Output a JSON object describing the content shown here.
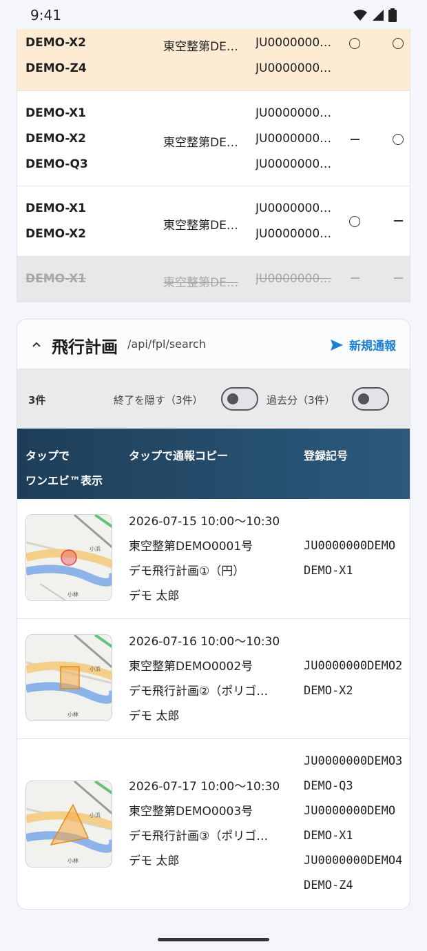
{
  "status": {
    "time": "9:41"
  },
  "top_rows": [
    {
      "names": [
        "DEMO-X2",
        "DEMO-Z4"
      ],
      "org": "東空整第DE…",
      "codes": [
        "JU0000000…",
        "JU0000000…"
      ],
      "m1": "circle",
      "m2": "circle"
    },
    {
      "names": [
        "DEMO-X1",
        "DEMO-X2",
        "DEMO-Q3"
      ],
      "org": "東空整第DE…",
      "codes": [
        "JU0000000…",
        "JU0000000…",
        "JU0000000…"
      ],
      "m1": "dash",
      "m2": "circle"
    },
    {
      "names": [
        "DEMO-X1",
        "DEMO-X2"
      ],
      "org": "東空整第DE…",
      "codes": [
        "JU0000000…",
        "JU0000000…"
      ],
      "m1": "circle",
      "m2": "dash"
    },
    {
      "names": [
        "DEMO-X1"
      ],
      "org": "東空整第DE…",
      "codes": [
        "JU0000000…"
      ],
      "m1": "dash",
      "m2": "dash"
    }
  ],
  "fpl": {
    "title": "飛行計画",
    "path": "/api/fpl/search",
    "new_report": "新規通報",
    "count": "3件",
    "hide_finished": "終了を隠す（3件）",
    "past": "過去分（3件）",
    "headers": {
      "col1_line1": "タップで",
      "col1_line2": "ワンエビ™表示",
      "col2": "タップで通報コピー",
      "col3": "登録記号"
    },
    "rows": [
      {
        "time": "2026-07-15 10:00〜10:30",
        "permit": "東空整第DEMO0001号",
        "plan": "デモ飛行計画①（円）",
        "person": "デモ 太郎",
        "regs": [
          "JU0000000DEMO",
          "DEMO-X1"
        ]
      },
      {
        "time": "2026-07-16 10:00〜10:30",
        "permit": "東空整第DEMO0002号",
        "plan": "デモ飛行計画②（ポリゴ…",
        "person": "デモ 太郎",
        "regs": [
          "JU0000000DEMO2",
          "DEMO-X2"
        ]
      },
      {
        "time": "2026-07-17 10:00〜10:30",
        "permit": "東空整第DEMO0003号",
        "plan": "デモ飛行計画③（ポリゴ…",
        "person": "デモ 太郎",
        "regs": [
          "JU0000000DEMO3",
          "DEMO-Q3",
          "JU0000000DEMO",
          "DEMO-X1",
          "JU0000000DEMO4",
          "DEMO-Z4"
        ]
      }
    ]
  },
  "map_labels": {
    "a": "小浜",
    "b": "小林"
  },
  "colors": {
    "accent": "#1e7fd0",
    "header_dark": "#1e3e58",
    "highlight": "#fdebd3"
  }
}
